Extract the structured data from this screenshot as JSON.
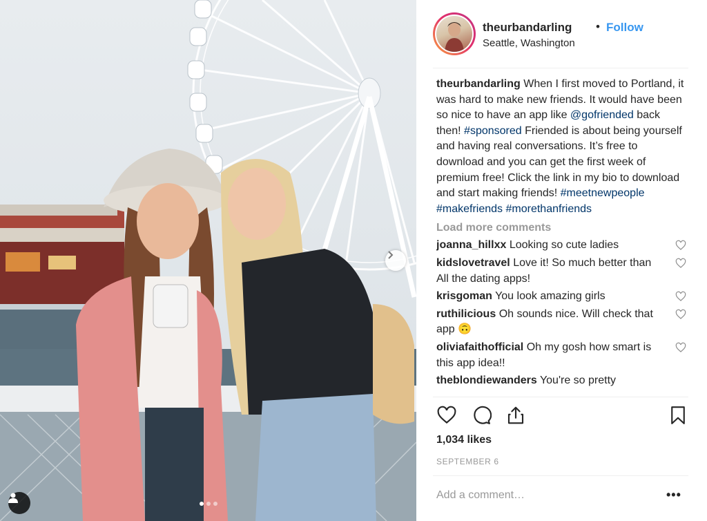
{
  "post": {
    "username": "theurbandarling",
    "separator": "•",
    "follow_label": "Follow",
    "location": "Seattle, Washington"
  },
  "caption": {
    "username": "theurbandarling",
    "text_1": "When I first moved to Portland, it was hard to make new friends. It would have been so nice to have an app like",
    "mention": "@gofriended",
    "text_2": "back then!",
    "hashtag_1": "#sponsored",
    "text_3": "Friended is about being yourself and having real conversations. It’s free to download and you can get the first week of premium free! Click the link in my bio to download and start making friends!",
    "hashtag_2": "#meetnewpeople",
    "hashtag_3": "#makefriends",
    "hashtag_4": "#morethanfriends"
  },
  "load_more": "Load more comments",
  "comments": [
    {
      "user": "joanna_hillxx",
      "text": "Looking so cute ladies"
    },
    {
      "user": "kidslovetravel",
      "text": "Love it! So much better than All the dating apps!"
    },
    {
      "user": "krisgoman",
      "text": "You look amazing girls"
    },
    {
      "user": "ruthilicious",
      "text": "Oh sounds nice. Will check that app 🙃"
    },
    {
      "user": "oliviafaithofficial",
      "text": "Oh my gosh how smart is this app idea!!"
    },
    {
      "user": "theblondiewanders",
      "text": "You're so pretty"
    }
  ],
  "likes": "1,034 likes",
  "date": "SEPTEMBER 6",
  "add_comment_placeholder": "Add a comment…",
  "more_label": "•••",
  "carousel": {
    "slides": 3,
    "active": 1
  },
  "icons": [
    "heart-icon",
    "comment-icon",
    "share-icon",
    "bookmark-icon",
    "next-arrow-icon",
    "tag-user-icon"
  ],
  "colors": {
    "follow_blue": "#3897f0",
    "link_blue": "#003569",
    "muted": "#999999",
    "text": "#262626"
  }
}
